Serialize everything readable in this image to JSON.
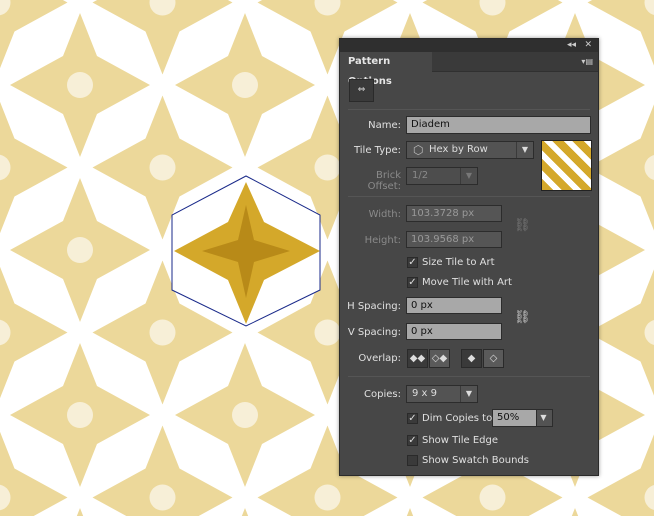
{
  "panel": {
    "title": "Pattern Options",
    "collapse_icon": "double-chevron-left-icon",
    "close_icon": "close-icon",
    "menu_icon": "panel-menu-icon",
    "tile_editor_icon": "pattern-tile-tool-icon",
    "name_label": "Name:",
    "name_value": "Diadem",
    "tile_type_label": "Tile Type:",
    "tile_type_value": "Hex by Row",
    "brick_offset_label": "Brick Offset:",
    "brick_offset_value": "1/2",
    "width_label": "Width:",
    "width_value": "103.3728 px",
    "height_label": "Height:",
    "height_value": "103.9568 px",
    "size_tile_to_art": {
      "label": "Size Tile to Art",
      "checked": true
    },
    "move_tile_with_art": {
      "label": "Move Tile with Art",
      "checked": true
    },
    "h_spacing_label": "H Spacing:",
    "h_spacing_value": "0 px",
    "v_spacing_label": "V Spacing:",
    "v_spacing_value": "0 px",
    "overlap_label": "Overlap:",
    "copies_label": "Copies:",
    "copies_value": "9 x 9",
    "dim_copies": {
      "label": "Dim Copies to:",
      "checked": true,
      "value": "50%"
    },
    "show_tile_edge": {
      "label": "Show Tile Edge",
      "checked": true
    },
    "show_swatch_bounds": {
      "label": "Show Swatch Bounds",
      "checked": false
    }
  },
  "colors": {
    "gold": "#d4a82a",
    "gold_faded": "#ecd89a",
    "tile_edge": "#1a2a8a",
    "panel_bg": "#474747"
  }
}
